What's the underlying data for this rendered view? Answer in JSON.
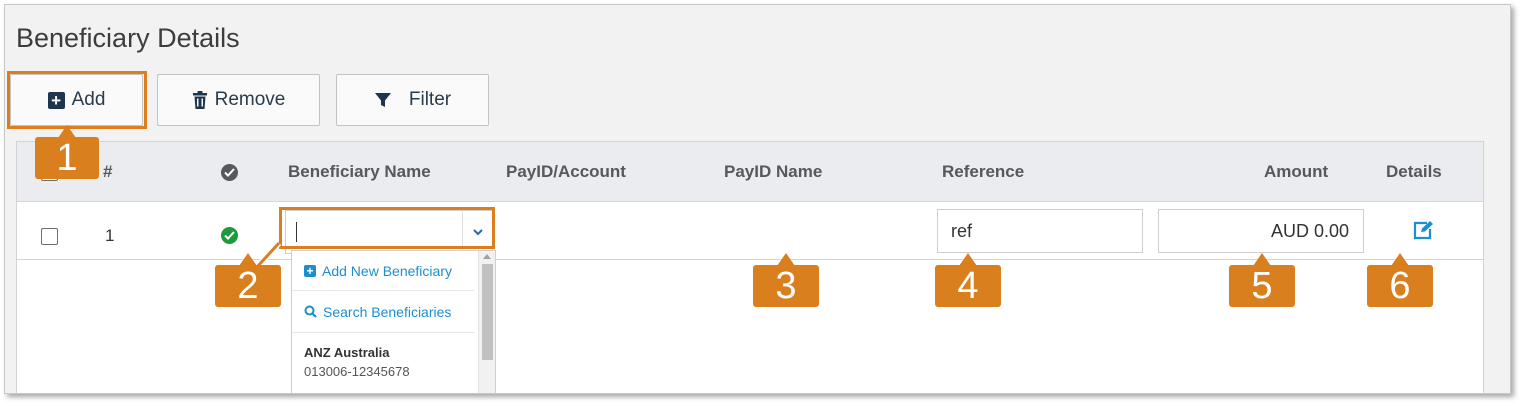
{
  "page": {
    "title": "Beneficiary Details"
  },
  "toolbar": {
    "add_label": "Add",
    "remove_label": "Remove",
    "filter_label": "Filter"
  },
  "table": {
    "headers": {
      "number": "#",
      "beneficiary_name": "Beneficiary Name",
      "payid_account": "PayID/Account",
      "payid_name": "PayID Name",
      "reference": "Reference",
      "amount": "Amount",
      "details": "Details"
    },
    "rows": [
      {
        "number": "1",
        "beneficiary_name": "",
        "reference": "ref",
        "amount": "AUD 0.00"
      }
    ]
  },
  "dropdown": {
    "add_new": "Add New Beneficiary",
    "search": "Search Beneficiaries",
    "options": [
      {
        "name": "ANZ Australia",
        "account": "013006-12345678"
      }
    ]
  },
  "callouts": [
    "1",
    "2",
    "3",
    "4",
    "5",
    "6"
  ],
  "colors": {
    "callout": "#d97f1e",
    "link": "#1d8fd0",
    "success": "#1a9b3c",
    "header_bg": "#eaecef"
  }
}
